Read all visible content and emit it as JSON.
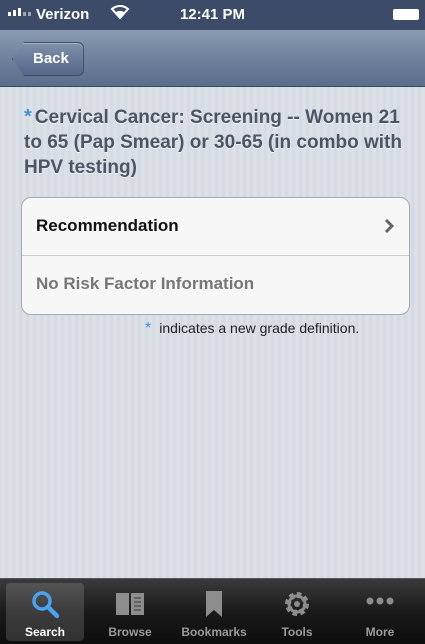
{
  "status": {
    "carrier": "Verizon",
    "time": "12:41 PM"
  },
  "nav": {
    "back_label": "Back"
  },
  "title": "Cervical Cancer: Screening -- Women 21 to 65 (Pap Smear) or 30-65 (in combo with HPV testing)",
  "star_symbol": "*",
  "rows": [
    {
      "label": "Recommendation"
    },
    {
      "label": "No Risk Factor Information"
    }
  ],
  "note": "indicates a new grade definition.",
  "colors": {
    "accent": "#3b8fe0",
    "navbar": "#6d7f9a",
    "statusbar": "#3c4c68"
  },
  "tabs": [
    {
      "label": "Search",
      "icon": "search-icon",
      "active": true
    },
    {
      "label": "Browse",
      "icon": "book-icon"
    },
    {
      "label": "Bookmarks",
      "icon": "bookmark-icon"
    },
    {
      "label": "Tools",
      "icon": "gear-icon"
    },
    {
      "label": "More",
      "icon": "more-icon"
    }
  ]
}
